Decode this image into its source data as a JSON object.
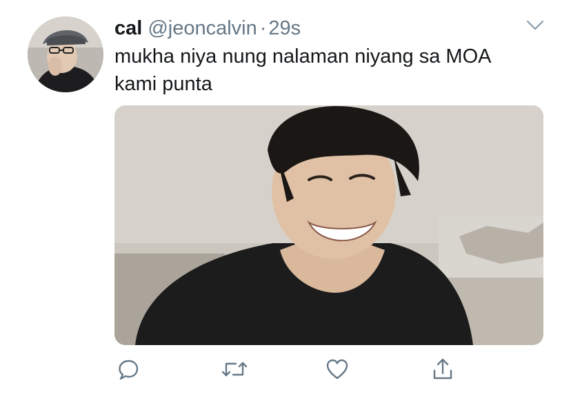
{
  "tweet": {
    "author": {
      "name": "cal",
      "handle": "@jeoncalvin",
      "separator": "·",
      "time": "29s"
    },
    "text_line1": "mukha niya nung nalaman niyang sa MOA",
    "text_line2": "kami punta"
  },
  "icons": {
    "more": "chevron-down-icon",
    "reply": "reply-icon",
    "retweet": "retweet-icon",
    "like": "heart-icon",
    "share": "share-icon"
  },
  "colors": {
    "text_primary": "#14171a",
    "text_secondary": "#657786",
    "icon": "#657786"
  }
}
